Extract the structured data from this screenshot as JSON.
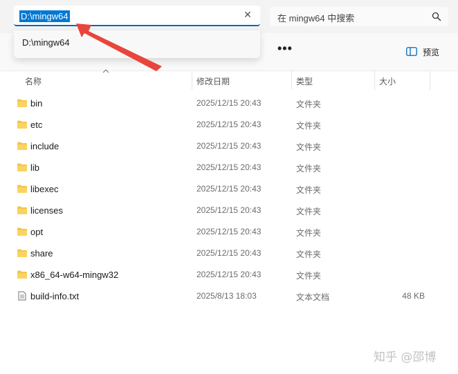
{
  "address_bar": {
    "value": "D:\\mingw64",
    "clear_icon": "close-icon"
  },
  "address_dropdown": {
    "items": [
      {
        "label": "D:\\mingw64"
      }
    ]
  },
  "search": {
    "placeholder": "在 mingw64 中搜索",
    "icon": "search-icon"
  },
  "toolbar": {
    "more_icon": "more-horizontal-icon",
    "more_label": "•••",
    "preview_icon": "preview-pane-icon",
    "preview_label": "预览"
  },
  "columns": {
    "name": "名称",
    "modified": "修改日期",
    "type": "类型",
    "size": "大小"
  },
  "files": [
    {
      "name": "bin",
      "modified": "2025/12/15 20:43",
      "type": "文件夹",
      "size": "",
      "icon": "folder-icon"
    },
    {
      "name": "etc",
      "modified": "2025/12/15 20:43",
      "type": "文件夹",
      "size": "",
      "icon": "folder-icon"
    },
    {
      "name": "include",
      "modified": "2025/12/15 20:43",
      "type": "文件夹",
      "size": "",
      "icon": "folder-icon"
    },
    {
      "name": "lib",
      "modified": "2025/12/15 20:43",
      "type": "文件夹",
      "size": "",
      "icon": "folder-icon"
    },
    {
      "name": "libexec",
      "modified": "2025/12/15 20:43",
      "type": "文件夹",
      "size": "",
      "icon": "folder-icon"
    },
    {
      "name": "licenses",
      "modified": "2025/12/15 20:43",
      "type": "文件夹",
      "size": "",
      "icon": "folder-icon"
    },
    {
      "name": "opt",
      "modified": "2025/12/15 20:43",
      "type": "文件夹",
      "size": "",
      "icon": "folder-icon"
    },
    {
      "name": "share",
      "modified": "2025/12/15 20:43",
      "type": "文件夹",
      "size": "",
      "icon": "folder-icon"
    },
    {
      "name": "x86_64-w64-mingw32",
      "modified": "2025/12/15 20:43",
      "type": "文件夹",
      "size": "",
      "icon": "folder-icon"
    },
    {
      "name": "build-info.txt",
      "modified": "2025/8/13 18:03",
      "type": "文本文档",
      "size": "48 KB",
      "icon": "text-file-icon"
    }
  ],
  "watermark": "知乎 @邵博",
  "colors": {
    "selection": "#0078d4",
    "address_underline": "#0067c0",
    "folder": "#f4c44e",
    "annotation_arrow": "#e8453c"
  }
}
